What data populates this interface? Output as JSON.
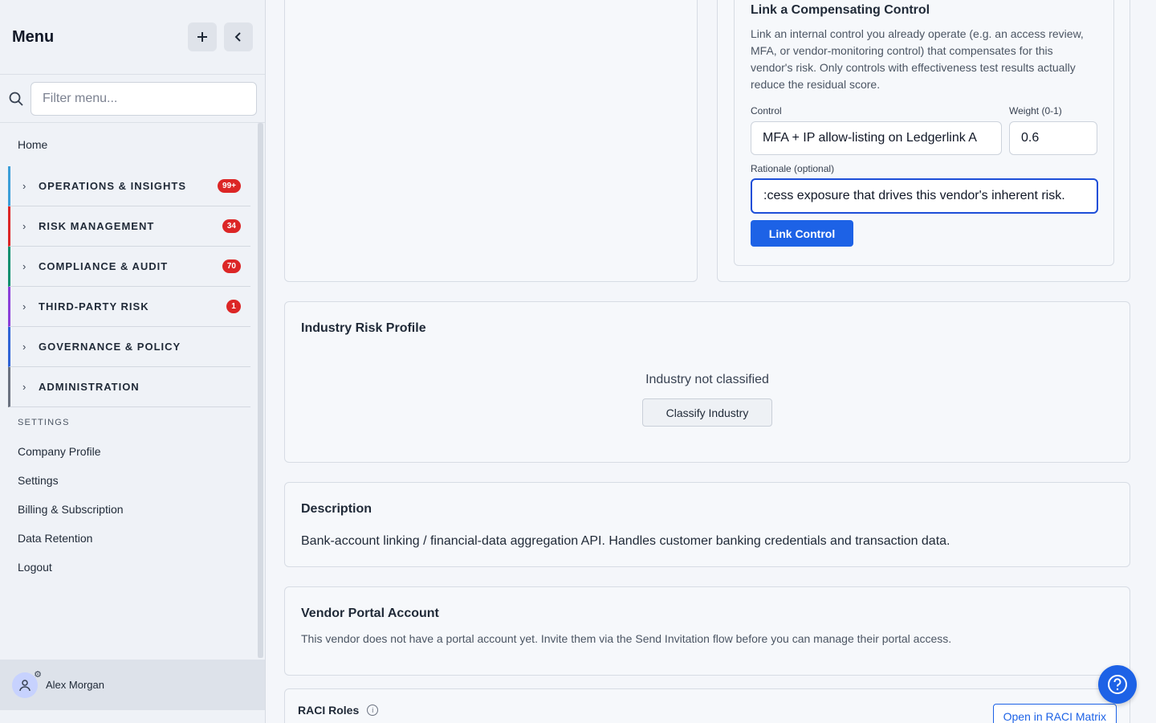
{
  "sidebar": {
    "title": "Menu",
    "add_icon": "plus-icon",
    "collapse_icon": "chevron-left-icon",
    "filter_placeholder": "Filter menu...",
    "home": "Home",
    "groups": [
      {
        "label": "OPERATIONS & INSIGHTS",
        "badge": "99+",
        "color": "#3b9ed8"
      },
      {
        "label": "RISK MANAGEMENT",
        "badge": "34",
        "color": "#dc2626"
      },
      {
        "label": "COMPLIANCE & AUDIT",
        "badge": "70",
        "color": "#0f8f6f"
      },
      {
        "label": "THIRD-PARTY RISK",
        "badge": "1",
        "color": "#8b3fd9"
      },
      {
        "label": "GOVERNANCE & POLICY",
        "badge": "",
        "color": "#2f63d6"
      },
      {
        "label": "ADMINISTRATION",
        "badge": "",
        "color": "#6b7280"
      }
    ],
    "settings_heading": "SETTINGS",
    "settings_items": [
      "Company Profile",
      "Settings",
      "Billing & Subscription",
      "Data Retention",
      "Logout"
    ],
    "user_name": "Alex Morgan"
  },
  "link_control": {
    "title": "Link a Compensating Control",
    "description": "Link an internal control you already operate (e.g. an access review, MFA, or vendor-monitoring control) that compensates for this vendor's risk. Only controls with effectiveness test results actually reduce the residual score.",
    "control_label": "Control",
    "control_value": "MFA + IP allow-listing on Ledgerlink A",
    "weight_label": "Weight (0-1)",
    "weight_value": "0.6",
    "rationale_label": "Rationale (optional)",
    "rationale_value": ":cess exposure that drives this vendor's inherent risk.",
    "button": "Link Control"
  },
  "industry": {
    "title": "Industry Risk Profile",
    "status": "Industry not classified",
    "button": "Classify Industry"
  },
  "description": {
    "title": "Description",
    "text": "Bank-account linking / financial-data aggregation API. Handles customer banking credentials and transaction data."
  },
  "portal": {
    "title": "Vendor Portal Account",
    "text": "This vendor does not have a portal account yet. Invite them via the Send Invitation flow before you can manage their portal access."
  },
  "raci": {
    "title": "RACI Roles",
    "info_icon": "info-icon",
    "button": "Open in RACI Matrix"
  },
  "help_icon": "help-icon"
}
